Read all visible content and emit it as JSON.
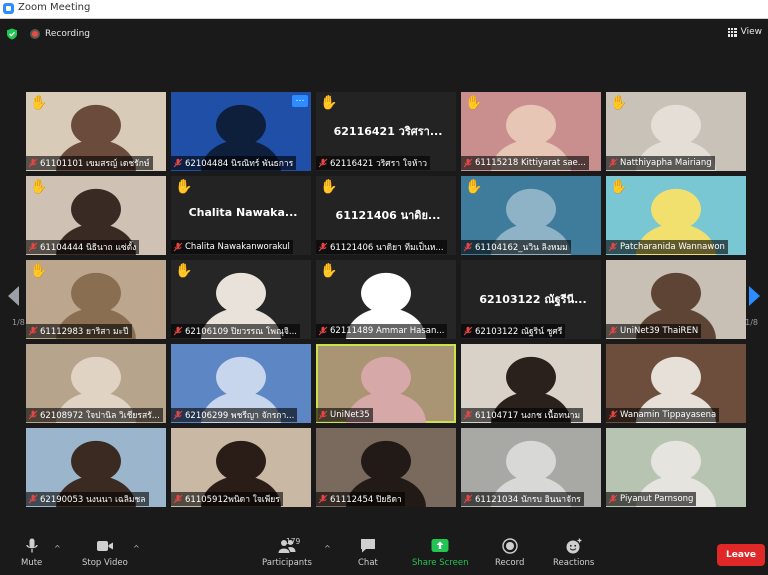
{
  "window": {
    "title": "Zoom Meeting"
  },
  "topbar": {
    "recording_label": "Recording",
    "view_label": "View"
  },
  "gallery": {
    "page_left": "1/8",
    "page_right": "1/8",
    "tiles": [
      {
        "label": "61101101 เขมสรญ์ เดชรักษ์",
        "big": "",
        "hand": true,
        "more": false,
        "speaking": false,
        "bg": "#d8cbb8",
        "photo": "#6b4c3c"
      },
      {
        "label": "62104484 นิรณิทร์ พันธการ",
        "big": "",
        "hand": false,
        "more": true,
        "speaking": false,
        "bg": "#1f4fa6",
        "photo": "#0d1f3a"
      },
      {
        "label": "62116421 วริศรา ใจห้าว",
        "big": "62116421 วริศรา...",
        "hand": true,
        "more": false,
        "speaking": false,
        "bg": "",
        "photo": ""
      },
      {
        "label": "61115218 Kittiyarat sae...",
        "big": "",
        "hand": true,
        "more": false,
        "speaking": false,
        "bg": "#c98f8f",
        "photo": "#e7c6b6"
      },
      {
        "label": "Natthiyapha Mairiang",
        "big": "",
        "hand": true,
        "more": false,
        "speaking": false,
        "bg": "#c9c2b8",
        "photo": "#e4ded6"
      },
      {
        "label": "61104444 นิธินาถ แซ่ตั้ง",
        "big": "",
        "hand": true,
        "more": false,
        "speaking": false,
        "bg": "#cfc2b4",
        "photo": "#3a2a24"
      },
      {
        "label": "Chalita Nawakanworakul",
        "big": "Chalita  Nawaka...",
        "hand": true,
        "more": false,
        "speaking": false,
        "bg": "",
        "photo": ""
      },
      {
        "label": "61121406 นาดิยา ทีมเป็นห...",
        "big": "61121406 นาดิย...",
        "hand": true,
        "more": false,
        "speaking": false,
        "bg": "",
        "photo": ""
      },
      {
        "label": "61104162_นวิน ลิงหมม",
        "big": "",
        "hand": true,
        "more": false,
        "speaking": false,
        "bg": "#3f7c9c",
        "photo": "#8fb3c6"
      },
      {
        "label": "Patcharanida Wannawon",
        "big": "",
        "hand": true,
        "more": false,
        "speaking": false,
        "bg": "#7ac7d4",
        "photo": "#f1e06d"
      },
      {
        "label": "61112983 ยาริสา มะปี",
        "big": "",
        "hand": true,
        "more": false,
        "speaking": false,
        "bg": "#bca78e",
        "photo": "#8a6e52"
      },
      {
        "label": "62106109 ปิยวรรณ โพณุจิ...",
        "big": "",
        "hand": true,
        "more": false,
        "speaking": false,
        "bg": "#262626",
        "photo": "#e8e2da"
      },
      {
        "label": "62111489 Ammar Hasan...",
        "big": "",
        "hand": true,
        "more": false,
        "speaking": false,
        "bg": "#262626",
        "photo": "#ffffff"
      },
      {
        "label": "62103122 ณัฐริน์ ชูศรี",
        "big": "62103122 ณัฐรีนี...",
        "hand": false,
        "more": false,
        "speaking": false,
        "bg": "",
        "photo": ""
      },
      {
        "label": "UniNet39 ThaiREN",
        "big": "",
        "hand": false,
        "more": false,
        "speaking": false,
        "bg": "#c8c0b4",
        "photo": "#5d4434"
      },
      {
        "label": "62108972 ใจปานิล วิเชียรสรั...",
        "big": "",
        "hand": false,
        "more": false,
        "speaking": false,
        "bg": "#b7a48c",
        "photo": "#e0d3c3"
      },
      {
        "label": "62106299 พชรีญา จักรกา...",
        "big": "",
        "hand": false,
        "more": false,
        "speaking": false,
        "bg": "#5c86c4",
        "photo": "#c7d6ec"
      },
      {
        "label": "UniNet35",
        "big": "",
        "hand": false,
        "more": false,
        "speaking": true,
        "bg": "#a99574",
        "photo": "#d6a8a8"
      },
      {
        "label": "61104717 นงกช เนื้อทนาม",
        "big": "",
        "hand": false,
        "more": false,
        "speaking": false,
        "bg": "#d8d2c8",
        "photo": "#2a201c"
      },
      {
        "label": "Wanamin Tippayasena",
        "big": "",
        "hand": false,
        "more": false,
        "speaking": false,
        "bg": "#6d4e3c",
        "photo": "#e6e0d8"
      },
      {
        "label": "62190053 นงนนา เฉลิมชล",
        "big": "",
        "hand": false,
        "more": false,
        "speaking": false,
        "bg": "#9bb6cc",
        "photo": "#3a2a22"
      },
      {
        "label": "61105912พนิดา ใจเพียร",
        "big": "",
        "hand": false,
        "more": false,
        "speaking": false,
        "bg": "#c9b8a4",
        "photo": "#2a1d18"
      },
      {
        "label": "61112454 ปิยธิดา",
        "big": "",
        "hand": false,
        "more": false,
        "speaking": false,
        "bg": "#7a6a5e",
        "photo": "#221a16"
      },
      {
        "label": "61121034 นักรบ อินนาจักร",
        "big": "",
        "hand": false,
        "more": false,
        "speaking": false,
        "bg": "#a8a8a4",
        "photo": "#d8d8d6"
      },
      {
        "label": "Piyanut Parnsong",
        "big": "",
        "hand": false,
        "more": false,
        "speaking": false,
        "bg": "#b8c4b2",
        "photo": "#e6e4de"
      }
    ]
  },
  "toolbar": {
    "mute": "Mute",
    "stop_video": "Stop Video",
    "participants": "Participants",
    "participants_count": "179",
    "chat": "Chat",
    "share_screen": "Share Screen",
    "record": "Record",
    "reactions": "Reactions",
    "leave": "Leave"
  },
  "colors": {
    "accent": "#2d8cff",
    "share": "#23c552",
    "leave": "#e02828",
    "speaking_border": "#cde14a",
    "muted": "#e64545"
  },
  "icons": [
    "shield-icon",
    "record-icon",
    "grid-icon",
    "raised-hand-icon",
    "muted-mic-icon",
    "mic-icon",
    "video-camera-icon",
    "participants-icon",
    "chat-icon",
    "share-screen-icon",
    "record-button-icon",
    "reactions-icon",
    "chevron-left-icon",
    "chevron-right-icon",
    "more-icon"
  ]
}
